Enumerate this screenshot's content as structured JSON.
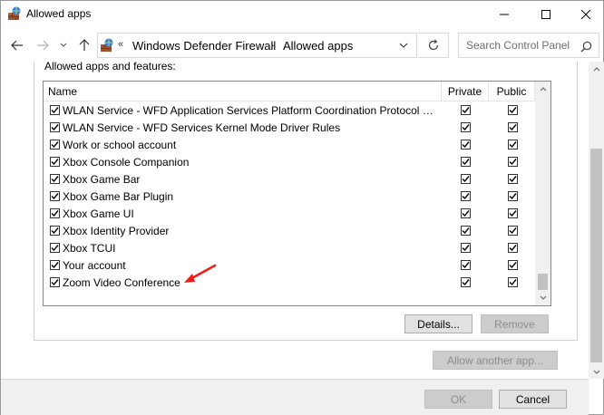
{
  "window": {
    "title": "Allowed apps",
    "icon": "firewall-allowed-apps-icon"
  },
  "navigation": {
    "back_icon": "arrow-left-icon",
    "forward_icon": "arrow-right-icon",
    "recent_icon": "chevron-down-icon",
    "up_icon": "arrow-up-icon",
    "breadcrumb_chevrons": "«",
    "breadcrumb": [
      "Windows Defender Firewall",
      "Allowed apps"
    ],
    "breadcrumb_separator": "›",
    "search_placeholder": "Search Control Panel"
  },
  "section": {
    "label": "Allowed apps and features:"
  },
  "table": {
    "columns": [
      "Name",
      "Private",
      "Public"
    ],
    "rows": [
      {
        "name": "WLAN Service - WFD Application Services Platform Coordination Protocol (U...",
        "enabled": true,
        "private": true,
        "public": true
      },
      {
        "name": "WLAN Service - WFD Services Kernel Mode Driver Rules",
        "enabled": true,
        "private": true,
        "public": true
      },
      {
        "name": "Work or school account",
        "enabled": true,
        "private": true,
        "public": true
      },
      {
        "name": "Xbox Console Companion",
        "enabled": true,
        "private": true,
        "public": true
      },
      {
        "name": "Xbox Game Bar",
        "enabled": true,
        "private": true,
        "public": true
      },
      {
        "name": "Xbox Game Bar Plugin",
        "enabled": true,
        "private": true,
        "public": true
      },
      {
        "name": "Xbox Game UI",
        "enabled": true,
        "private": true,
        "public": true
      },
      {
        "name": "Xbox Identity Provider",
        "enabled": true,
        "private": true,
        "public": true
      },
      {
        "name": "Xbox TCUI",
        "enabled": true,
        "private": true,
        "public": true
      },
      {
        "name": "Your account",
        "enabled": true,
        "private": true,
        "public": true
      },
      {
        "name": "Zoom Video Conference",
        "enabled": true,
        "private": true,
        "public": true
      }
    ]
  },
  "buttons": {
    "details": "Details...",
    "remove": "Remove",
    "allow_another": "Allow another app...",
    "ok": "OK",
    "cancel": "Cancel"
  },
  "colors": {
    "annotation_arrow": "#e8201c",
    "disabled_text": "#8c8c8c"
  }
}
